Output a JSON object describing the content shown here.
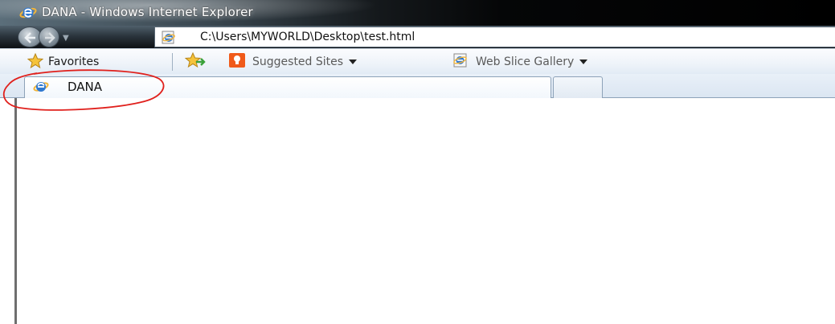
{
  "window": {
    "title": "DANA - Windows Internet Explorer"
  },
  "navigation": {
    "back_icon": "back-arrow-icon",
    "forward_icon": "forward-arrow-icon",
    "history_dropdown_icon": "chevron-down-icon"
  },
  "address_bar": {
    "url": "C:\\Users\\MYWORLD\\Desktop\\test.html",
    "icon": "ie-page-icon"
  },
  "favorites_bar": {
    "favorites_label": "Favorites",
    "favorites_icon": "star-icon",
    "add_to_favorites_icon": "add-star-icon",
    "suggested_sites_label": "Suggested Sites",
    "suggested_sites_icon": "suggested-sites-icon",
    "web_slice_gallery_label": "Web Slice Gallery",
    "web_slice_gallery_icon": "ie-page-icon"
  },
  "tabs": [
    {
      "label": "DANA",
      "icon": "ie-icon",
      "active": true
    }
  ],
  "new_tab": {
    "icon": "new-tab-icon"
  },
  "colors": {
    "title_bar": "#000000",
    "favorites_bar": "#eef3f9",
    "tab_active": "#ffffff",
    "annotation": "#e0201c"
  }
}
